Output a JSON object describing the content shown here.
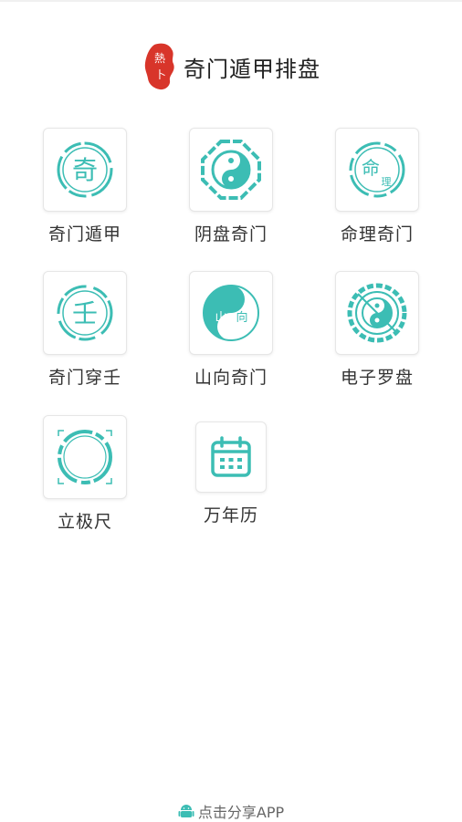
{
  "header": {
    "logo_text": "熱卜",
    "title": "奇门遁甲排盘"
  },
  "accent_color": "#3cbdb4",
  "logo_color": "#d8352a",
  "items": [
    {
      "label": "奇门遁甲",
      "icon": "qi-seal-icon",
      "glyph": "奇"
    },
    {
      "label": "阴盘奇门",
      "icon": "yin-yang-octagon-icon"
    },
    {
      "label": "命理奇门",
      "icon": "mingli-seal-icon",
      "glyph": "命",
      "glyph2": "理"
    },
    {
      "label": "奇门穿壬",
      "icon": "ren-seal-icon",
      "glyph": "壬"
    },
    {
      "label": "山向奇门",
      "icon": "shan-xiang-yin-yang-icon",
      "glyph": "山",
      "glyph2": "向"
    },
    {
      "label": "电子罗盘",
      "icon": "compass-bagua-icon"
    },
    {
      "label": "立极尺",
      "icon": "ring-icon"
    },
    {
      "label": "万年历",
      "icon": "calendar-icon"
    }
  ],
  "footer": {
    "icon": "android-icon",
    "text": "点击分享APP"
  }
}
